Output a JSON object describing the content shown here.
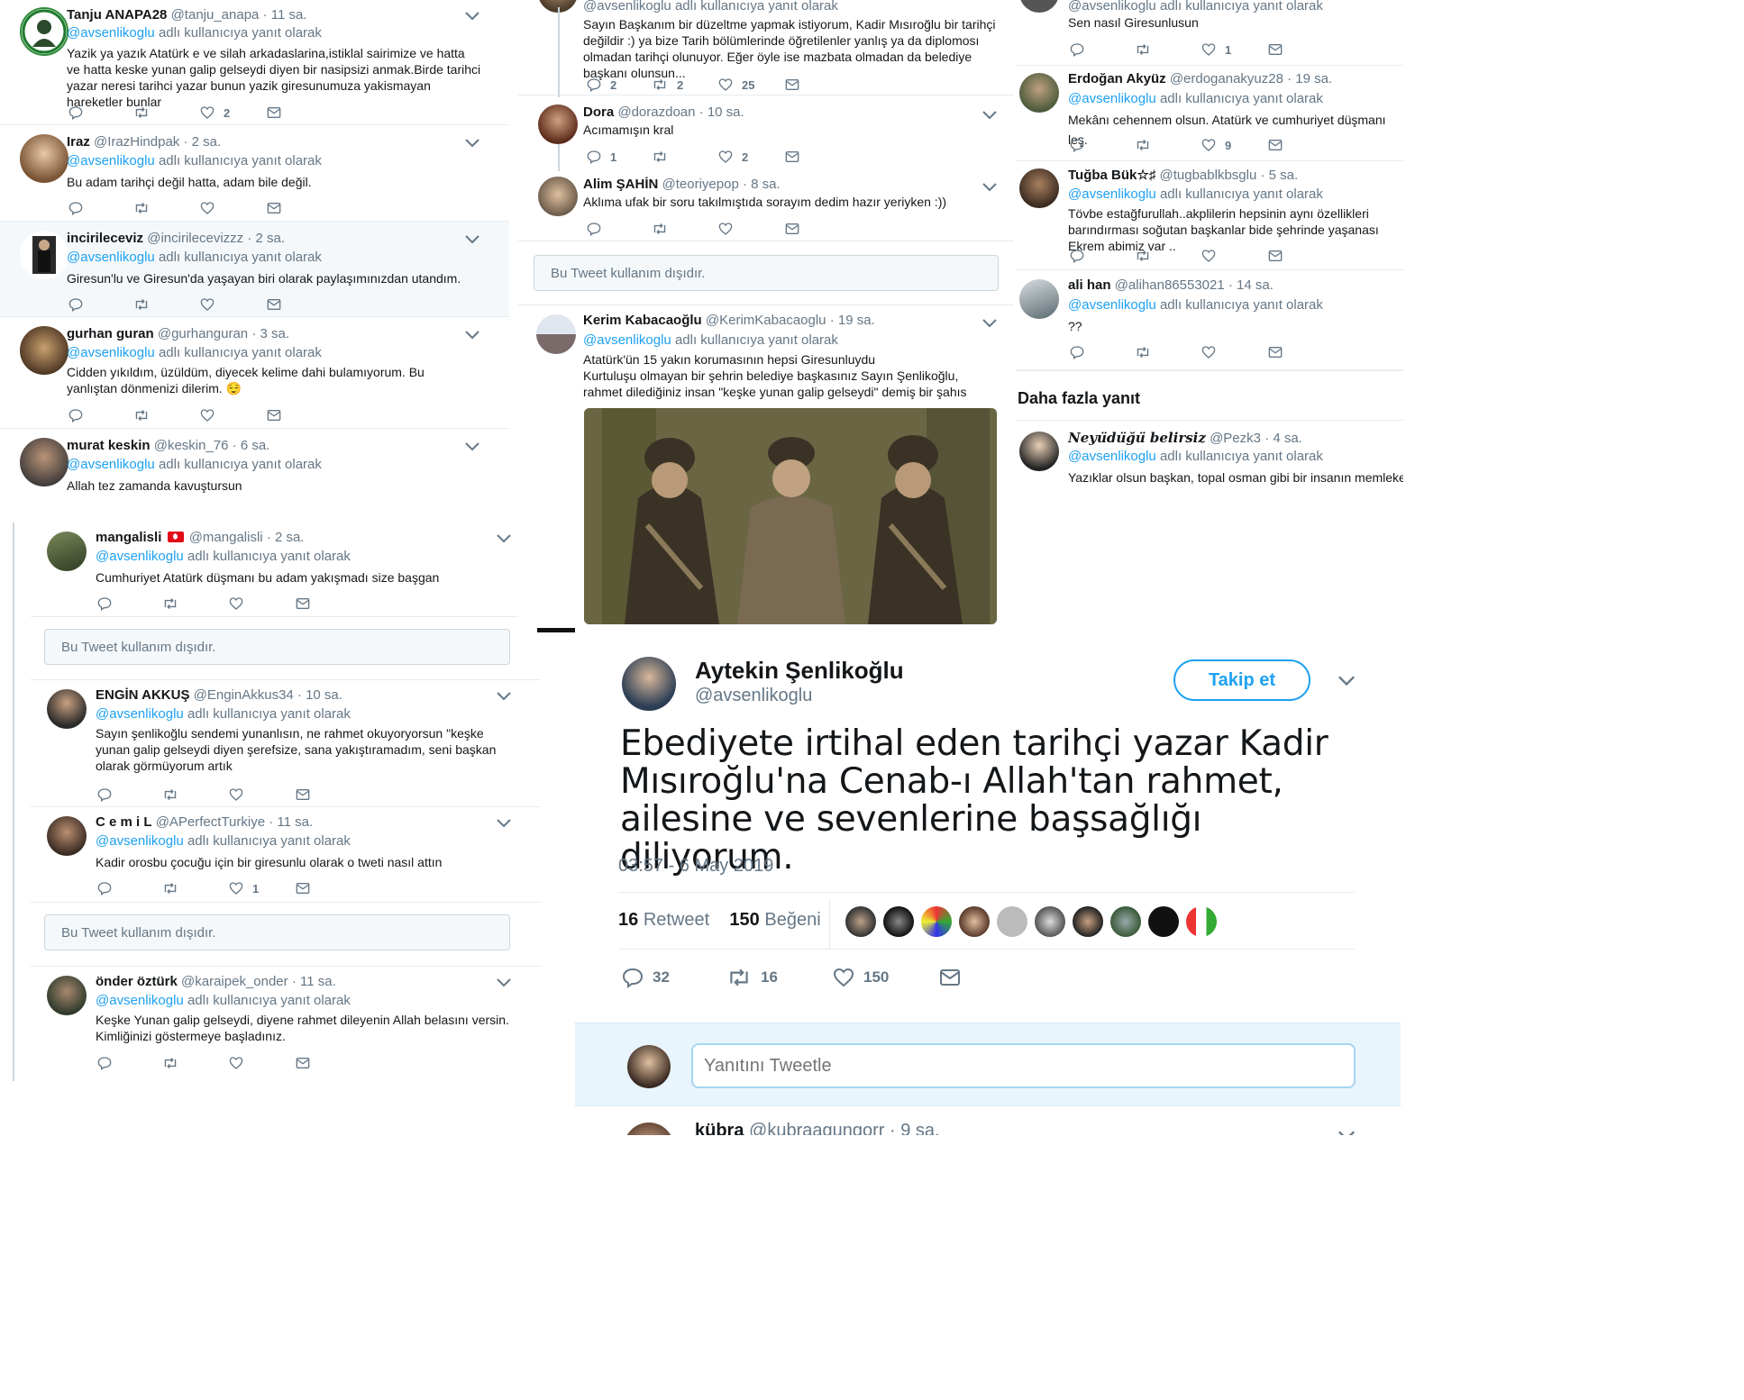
{
  "mention": "@avsenlikoglu",
  "reply_suffix": "adlı kullanıcıya yanıt olarak",
  "unavailable_text": "Bu Tweet kullanım dışıdır.",
  "colors": {
    "accent": "#1da1f2",
    "text": "#14171a",
    "muted": "#657786",
    "border": "#e6ecf0",
    "like_red": "#e0245e"
  },
  "col1": [
    {
      "name": "Tanju ANAPA28",
      "handle": "@tanju_anapa",
      "time": "· 11 sa.",
      "text": "Yazik ya yazık Atatürk e ve silah arkadaslarina,istiklal sairimize ve hatta ve hatta keske yunan galip gelseydi diyen bir nasipsizi anmak.Birde tarihci yazar neresi tarihci yazar bunun yazik giresunumuza yakismayan hareketler bunlar",
      "likes": "2",
      "avatar": "logo"
    },
    {
      "name": "Iraz",
      "handle": "@IrazHindpak",
      "time": "· 2 sa.",
      "text": "Bu adam tarihçi değil hatta, adam bile değil.",
      "avatar": "photo"
    },
    {
      "name": "incirileceviz",
      "handle": "@incirilecevizzz",
      "time": "· 2 sa.",
      "text": "Giresun'lu ve Giresun'da yaşayan biri olarak paylaşımınızdan utandım.",
      "avatar": "photo"
    },
    {
      "name": "gurhan guran",
      "handle": "@gurhanguran",
      "time": "· 3 sa.",
      "text": "Cidden yıkıldım, üzüldüm, diyecek kelime dahi bulamıyorum. Bu yanlıştan dönmenizi dilerim. 😌",
      "avatar": "photo"
    },
    {
      "name": "murat keskin",
      "handle": "@keskin_76",
      "time": "· 6 sa.",
      "text": "Allah tez zamanda kavuştursun",
      "avatar": "photo"
    }
  ],
  "col1b": [
    {
      "name": "mangalisli",
      "handle": "@mangalisli",
      "time": "· 2 sa.",
      "text": "Cumhuriyet Atatürk düşmanı bu adam yakışmadı size başgan",
      "flag": true
    },
    {
      "name": "ENGİN AKKUŞ",
      "handle": "@EnginAkkus34",
      "time": "· 10 sa.",
      "text": "Sayın şenlikoğlu sendemi yunanlısın, ne rahmet okuyoryorsun \"keşke yunan galip gelseydi diyen şerefsize, sana yakıştıramadım, seni başkan olarak görmüyorum artık"
    },
    {
      "name": "C e m i L",
      "handle": "@APerfectTurkiye",
      "time": "· 11 sa.",
      "text": "Kadir orosbu çocuğu için bir giresunlu olarak o tweti nasıl attın",
      "likes": "1"
    },
    {
      "name": "önder öztürk",
      "handle": "@karaipek_onder",
      "time": "· 11 sa.",
      "text": "Keşke Yunan galip gelseydi, diyene rahmet dileyenin Allah belasını versin. Kimliğinizi göstermeye başladınız."
    }
  ],
  "col2_top": {
    "partial_reply": "@avsenlikoglu adlı kullanıcıya yanıt olarak",
    "text": "Sayın Başkanım bir düzeltme yapmak istiyorum, Kadir Mısıroğlu bir tarihçi değildir :) ya bize Tarih bölümlerinde öğretilenler yanlış ya da diplomosı olmadan tarihçi olunuyor. Eğer öyle ise mazbata olmadan da belediye başkanı olunsun...",
    "replies": "2",
    "retweets": "2",
    "likes": "25"
  },
  "col2": [
    {
      "name": "Dora",
      "handle": "@dorazdoan",
      "time": "· 10 sa.",
      "text": "Acımamışın kral",
      "replies": "1",
      "likes": "2"
    },
    {
      "name": "Alim ŞAHİN",
      "handle": "@teoriyepop",
      "time": "· 8 sa.",
      "text": "Aklıma ufak bir soru takılmıştıda sorayım dedim hazır yeriyken :))"
    }
  ],
  "col2_kerim": {
    "name": "Kerim Kabacaoğlu",
    "handle": "@KerimKabacaoglu",
    "time": "· 19 sa.",
    "text": "Atatürk'ün 15 yakın korumasının hepsi Giresunluydu\nKurtuluşu olmayan bir şehrin belediye başkasınız Sayın Şenlikoğlu, rahmet dilediğiniz insan \"keşke yunan galip gelseydi\" demiş bir şahıs"
  },
  "col3_top": {
    "partial_reply": "@avsenlikoglu adlı kullanıcıya yanıt olarak",
    "text": "Sen nasıl Giresunlusun",
    "likes": "1"
  },
  "col3": [
    {
      "name": "Erdoğan Akyüz",
      "handle": "@erdoganakyuz28",
      "time": "· 19 sa.",
      "text": "Mekânı cehennem olsun. Atatürk ve cumhuriyet düşmanı leş.",
      "likes": "9"
    },
    {
      "name": "Tuğba Bük☆♯",
      "handle": "@tugbablkbsglu",
      "time": "· 5 sa.",
      "text": "Tövbe estağfurullah..akplilerin hepsinin aynı özellikleri barındırması soğutan başkanlar bide şehrinde yaşanası Ekrem abimiz var .."
    },
    {
      "name": "ali han",
      "handle": "@alihan86553021",
      "time": "· 14 sa.",
      "text": "??"
    }
  ],
  "more_replies_title": "Daha fazla yanıt",
  "col3_more": {
    "name": "𝑵𝒆𝒚𝒖̈𝒅𝒖̈𝒈̆𝒖̈ 𝒃𝒆𝒍𝒊𝒓𝒔𝒊𝒛",
    "handle": "@Pezk3",
    "time": "· 4 sa.",
    "text": "Yazıklar olsun başkan, topal osman gibi bir insanın memleketinden"
  },
  "main": {
    "name": "Aytekin Şenlikoğlu",
    "handle": "@avsenlikoglu",
    "follow_label": "Takip et",
    "text": "Ebediyete irtihal eden tarihçi yazar Kadir Mısıroğlu'na Cenab-ı Allah'tan rahmet, ailesine ve sevenlerine başsağlığı diliyorum.",
    "timestamp": "03:57 - 6 May 2019",
    "retweet_count": "16",
    "retweet_label": "Retweet",
    "like_count": "150",
    "like_label": "Beğeni",
    "reply_count": "32",
    "rt_action_count": "16",
    "like_action_count": "150",
    "reply_placeholder": "Yanıtını Tweetle",
    "next_name": "kübra",
    "next_handle": "@kubraagungorr",
    "next_time": "· 9 sa."
  }
}
